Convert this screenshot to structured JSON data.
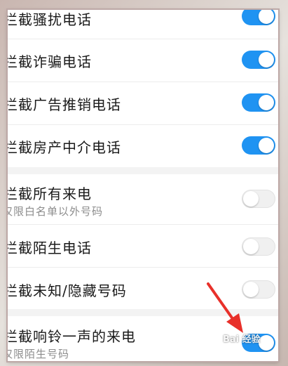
{
  "settings": {
    "items": [
      {
        "label": "拦截骚扰电话",
        "enabled": true
      },
      {
        "label": "拦截诈骗电话",
        "enabled": true
      },
      {
        "label": "拦截广告推销电话",
        "enabled": true
      },
      {
        "label": "拦截房产中介电话",
        "enabled": true
      },
      {
        "label": "拦截所有来电",
        "sub": "仅限白名单以外号码",
        "enabled": false
      },
      {
        "label": "拦截陌生电话",
        "enabled": false
      },
      {
        "label": "拦截未知/隐藏号码",
        "enabled": false
      },
      {
        "label": "拦截响铃一声的来电",
        "sub": "仅限陌生号码",
        "enabled": true
      }
    ]
  },
  "colors": {
    "toggle_on": "#1f93f2",
    "toggle_off": "#f0f0f0",
    "annotation_arrow": "#e8302a"
  },
  "watermark": {
    "text": "Bai 经验"
  }
}
